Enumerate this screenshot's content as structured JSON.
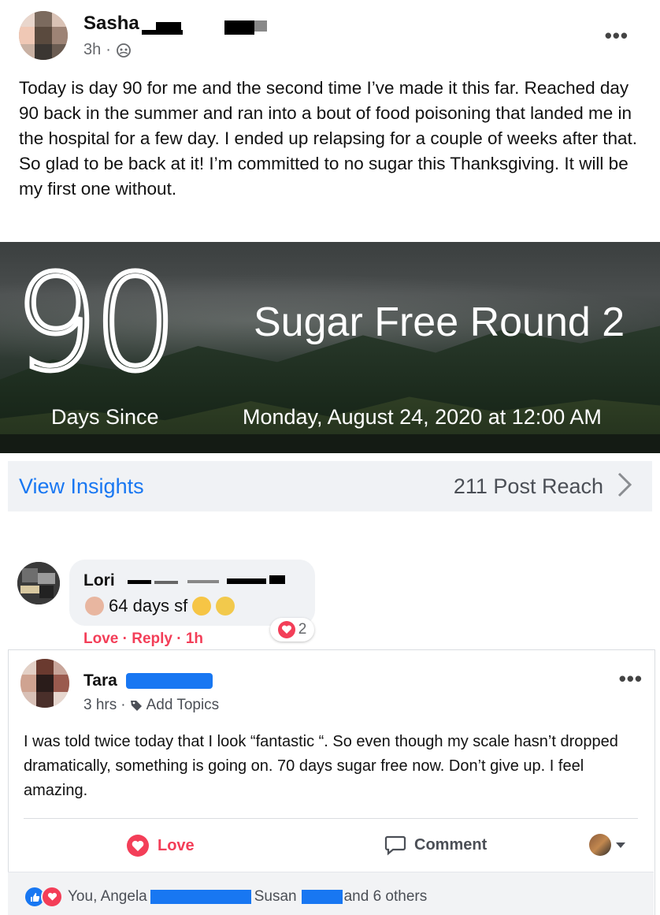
{
  "post1": {
    "author": "Sasha",
    "time": "3h",
    "separator": "·",
    "more": "•••",
    "text": "Today is day 90 for me and the second time I’ve made it this far. Reached day 90 back in the summer and ran into a bout of food poisoning that landed me in the hospital for a few day. I ended up relapsing for a couple of weeks after that. So glad to be back at it! I’m committed to no sugar this Thanksgiving. It will be my first one without.",
    "banner": {
      "number": "90",
      "title": "Sugar Free Round 2",
      "left_caption": "Days Since",
      "right_caption": "Monday, August 24, 2020 at 12:00 AM"
    },
    "insights": {
      "link": "View Insights",
      "reach": "211 Post Reach"
    }
  },
  "comment": {
    "author": "Lori",
    "text": "64 days sf",
    "actions": "Love · Reply · 1h",
    "reaction_count": "2"
  },
  "post2": {
    "author": "Tara",
    "time": "3 hrs",
    "separator": "·",
    "topics": "Add Topics",
    "more": "•••",
    "text": "I was told twice today that I look “fantastic “. So even though my scale hasn’t dropped dramatically, something is going on. 70 days sugar free now. Don’t give up. I feel amazing.",
    "love_label": "Love",
    "comment_label": "Comment",
    "reactions": {
      "you": "You, Angela",
      "susan": "Susan",
      "others": "and 6 others"
    }
  },
  "colors": {
    "accent": "#1877f2",
    "love": "#f33e58",
    "muted": "#65676b"
  }
}
